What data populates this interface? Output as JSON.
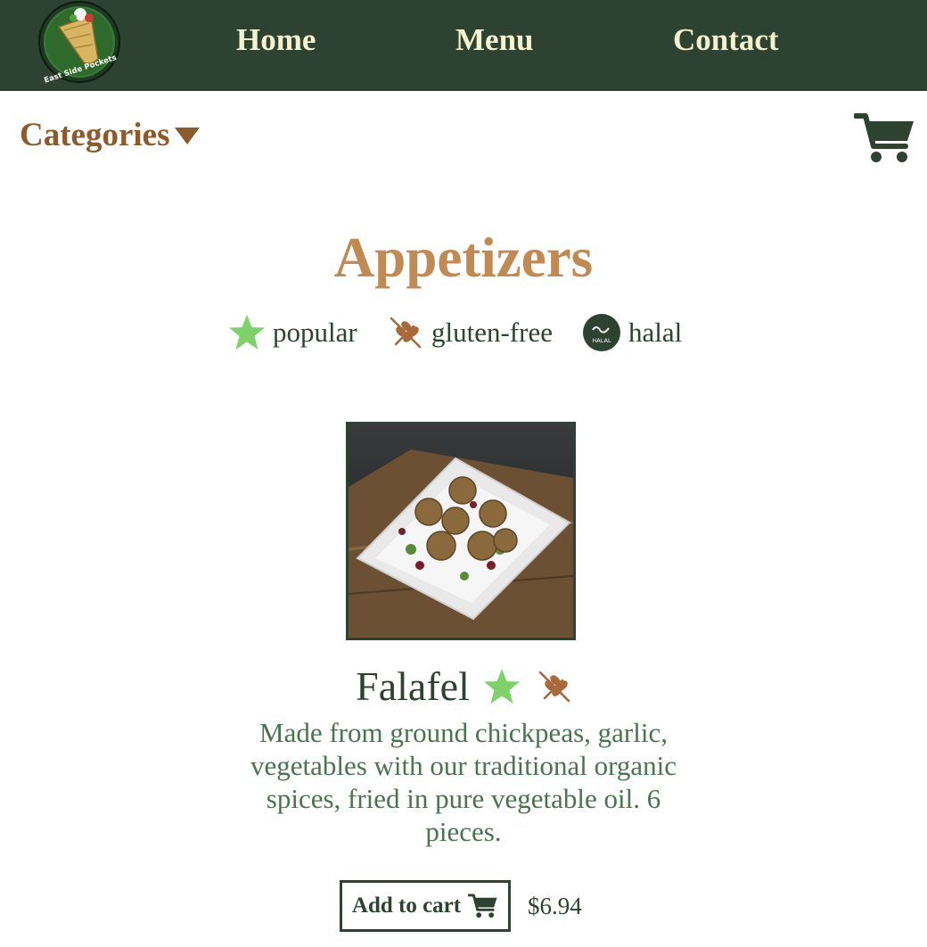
{
  "nav": {
    "logo_text": "East Side Pockets",
    "links": [
      "Home",
      "Menu",
      "Contact"
    ]
  },
  "toolbar": {
    "categories_label": "Categories",
    "caret_icon": "caret-down-icon",
    "cart_icon": "shopping-cart-icon"
  },
  "page": {
    "title": "Appetizers"
  },
  "legend": [
    {
      "icon": "star-icon",
      "label": "popular"
    },
    {
      "icon": "wheat-crossed-icon",
      "label": "gluten-free"
    },
    {
      "icon": "halal-icon",
      "label": "halal"
    }
  ],
  "item": {
    "name": "Falafel",
    "badges": [
      "star-icon",
      "wheat-crossed-icon"
    ],
    "description": "Made from ground chickpeas, garlic, vegetables with our traditional organic spices, fried in pure vegetable oil. 6 pieces.",
    "add_label": "Add to cart",
    "price": "$6.94"
  },
  "colors": {
    "nav_bg": "#2d4230",
    "nav_text": "#f4f2cf",
    "accent_brown": "#8c5a2b",
    "title_tan": "#c08a52",
    "star_green": "#7dd26a",
    "desc_green": "#4a7450"
  }
}
